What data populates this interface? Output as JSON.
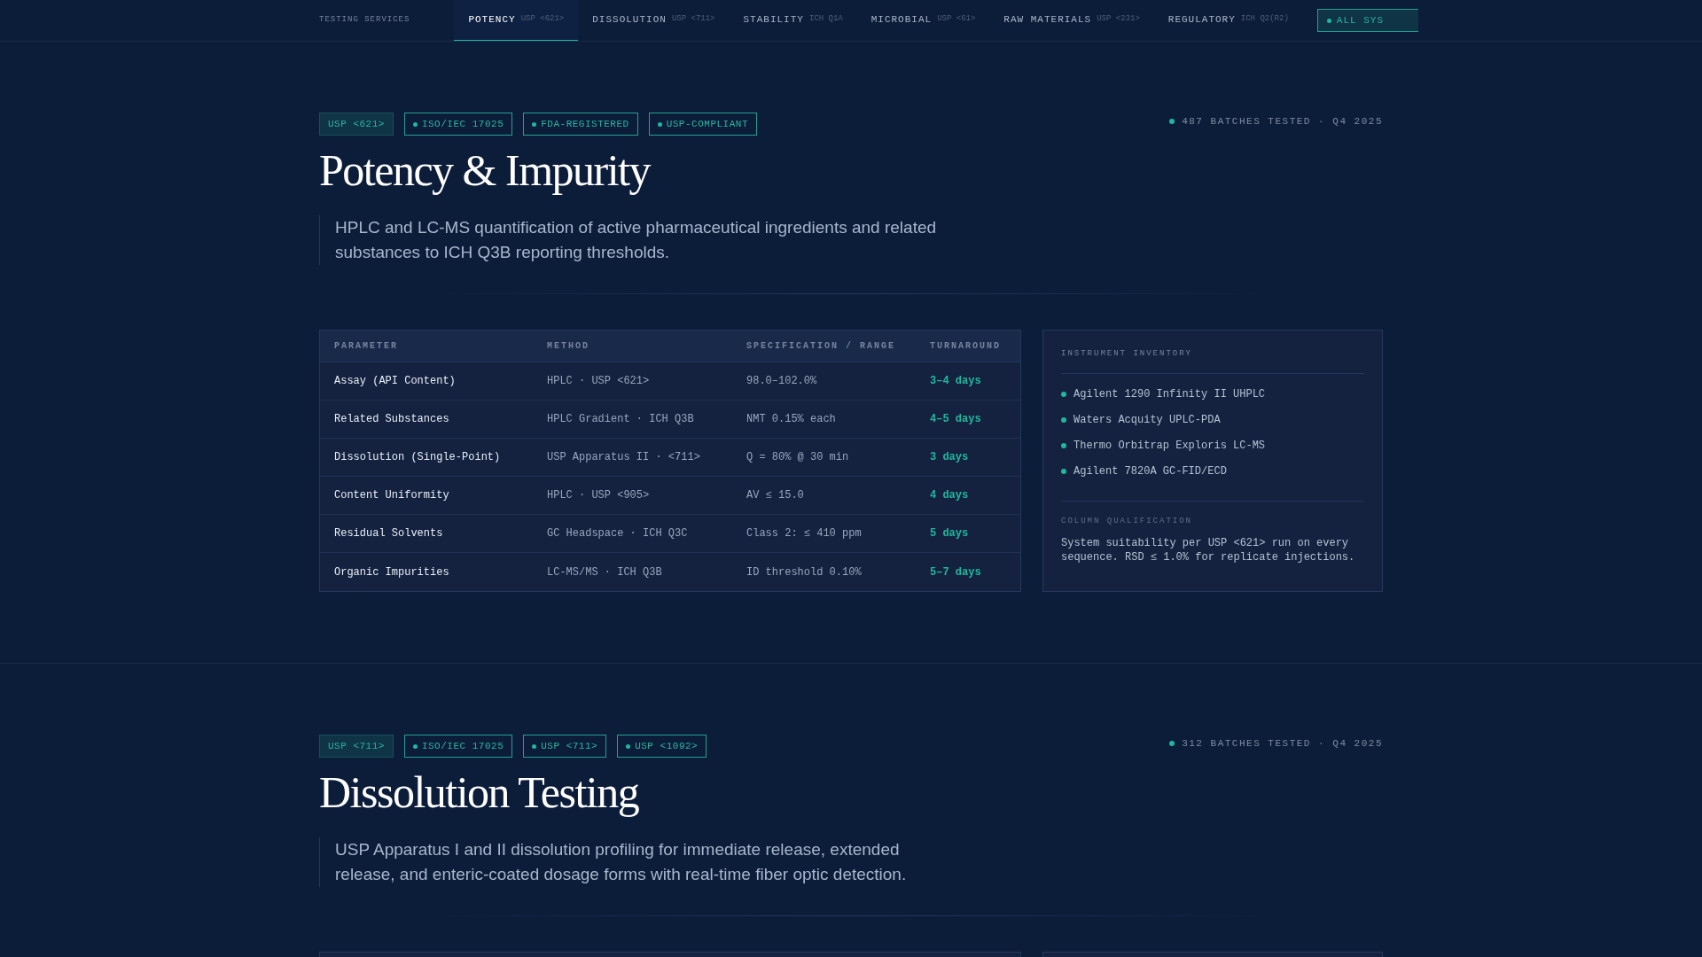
{
  "nav": {
    "brand": "TESTING SERVICES",
    "tabs": [
      {
        "label": "POTENCY",
        "code": "USP <621>",
        "selected": true
      },
      {
        "label": "DISSOLUTION",
        "code": "USP <711>",
        "selected": false
      },
      {
        "label": "STABILITY",
        "code": "ICH Q1A",
        "selected": false
      },
      {
        "label": "MICROBIAL",
        "code": "USP <61>",
        "selected": false
      },
      {
        "label": "RAW MATERIALS",
        "code": "USP <231>",
        "selected": false
      },
      {
        "label": "REGULATORY",
        "code": "ICH Q2(R2)",
        "selected": false
      }
    ],
    "button": "ALL SYS"
  },
  "sections": [
    {
      "badges": [
        {
          "label": "USP <621>",
          "kind": "solid"
        },
        {
          "label": "ISO/IEC 17025",
          "kind": "dot"
        },
        {
          "label": "FDA-REGISTERED",
          "kind": "dot"
        },
        {
          "label": "USP-COMPLIANT",
          "kind": "dot"
        }
      ],
      "stat": "487 BATCHES TESTED · Q4 2025",
      "title": "Potency & Impurity",
      "description": "HPLC and LC-MS quantification of active pharmaceutical ingredients and related substances to ICH Q3B reporting thresholds.",
      "table": {
        "columns": [
          "PARAMETER",
          "METHOD",
          "SPECIFICATION / RANGE",
          "TURNAROUND"
        ],
        "rows": [
          [
            "Assay (API Content)",
            "HPLC · USP <621>",
            "98.0–102.0%",
            "3–4 days"
          ],
          [
            "Related Substances",
            "HPLC Gradient · ICH Q3B",
            "NMT 0.15% each",
            "4–5 days"
          ],
          [
            "Dissolution (Single-Point)",
            "USP Apparatus II · <711>",
            "Q = 80% @ 30 min",
            "3 days"
          ],
          [
            "Content Uniformity",
            "HPLC · USP <905>",
            "AV ≤ 15.0",
            "4 days"
          ],
          [
            "Residual Solvents",
            "GC Headspace · ICH Q3C",
            "Class 2: ≤ 410 ppm",
            "5 days"
          ],
          [
            "Organic Impurities",
            "LC-MS/MS · ICH Q3B",
            "ID threshold 0.10%",
            "5–7 days"
          ]
        ]
      },
      "sidebar": {
        "heading": "INSTRUMENT INVENTORY",
        "instruments": [
          "Agilent 1290 Infinity II UHPLC",
          "Waters Acquity UPLC-PDA",
          "Thermo Orbitrap Exploris LC-MS",
          "Agilent 7820A GC-FID/ECD"
        ],
        "note_heading": "COLUMN QUALIFICATION",
        "note": "System suitability per USP <621> run on every sequence. RSD ≤ 1.0% for replicate injections."
      }
    },
    {
      "badges": [
        {
          "label": "USP <711>",
          "kind": "solid"
        },
        {
          "label": "ISO/IEC 17025",
          "kind": "dot"
        },
        {
          "label": "USP <711>",
          "kind": "dot"
        },
        {
          "label": "USP <1092>",
          "kind": "dot"
        }
      ],
      "stat": "312 BATCHES TESTED · Q4 2025",
      "title": "Dissolution Testing",
      "description": "USP Apparatus I and II dissolution profiling for immediate release, extended release, and enteric-coated dosage forms with real-time fiber optic detection."
    }
  ]
}
